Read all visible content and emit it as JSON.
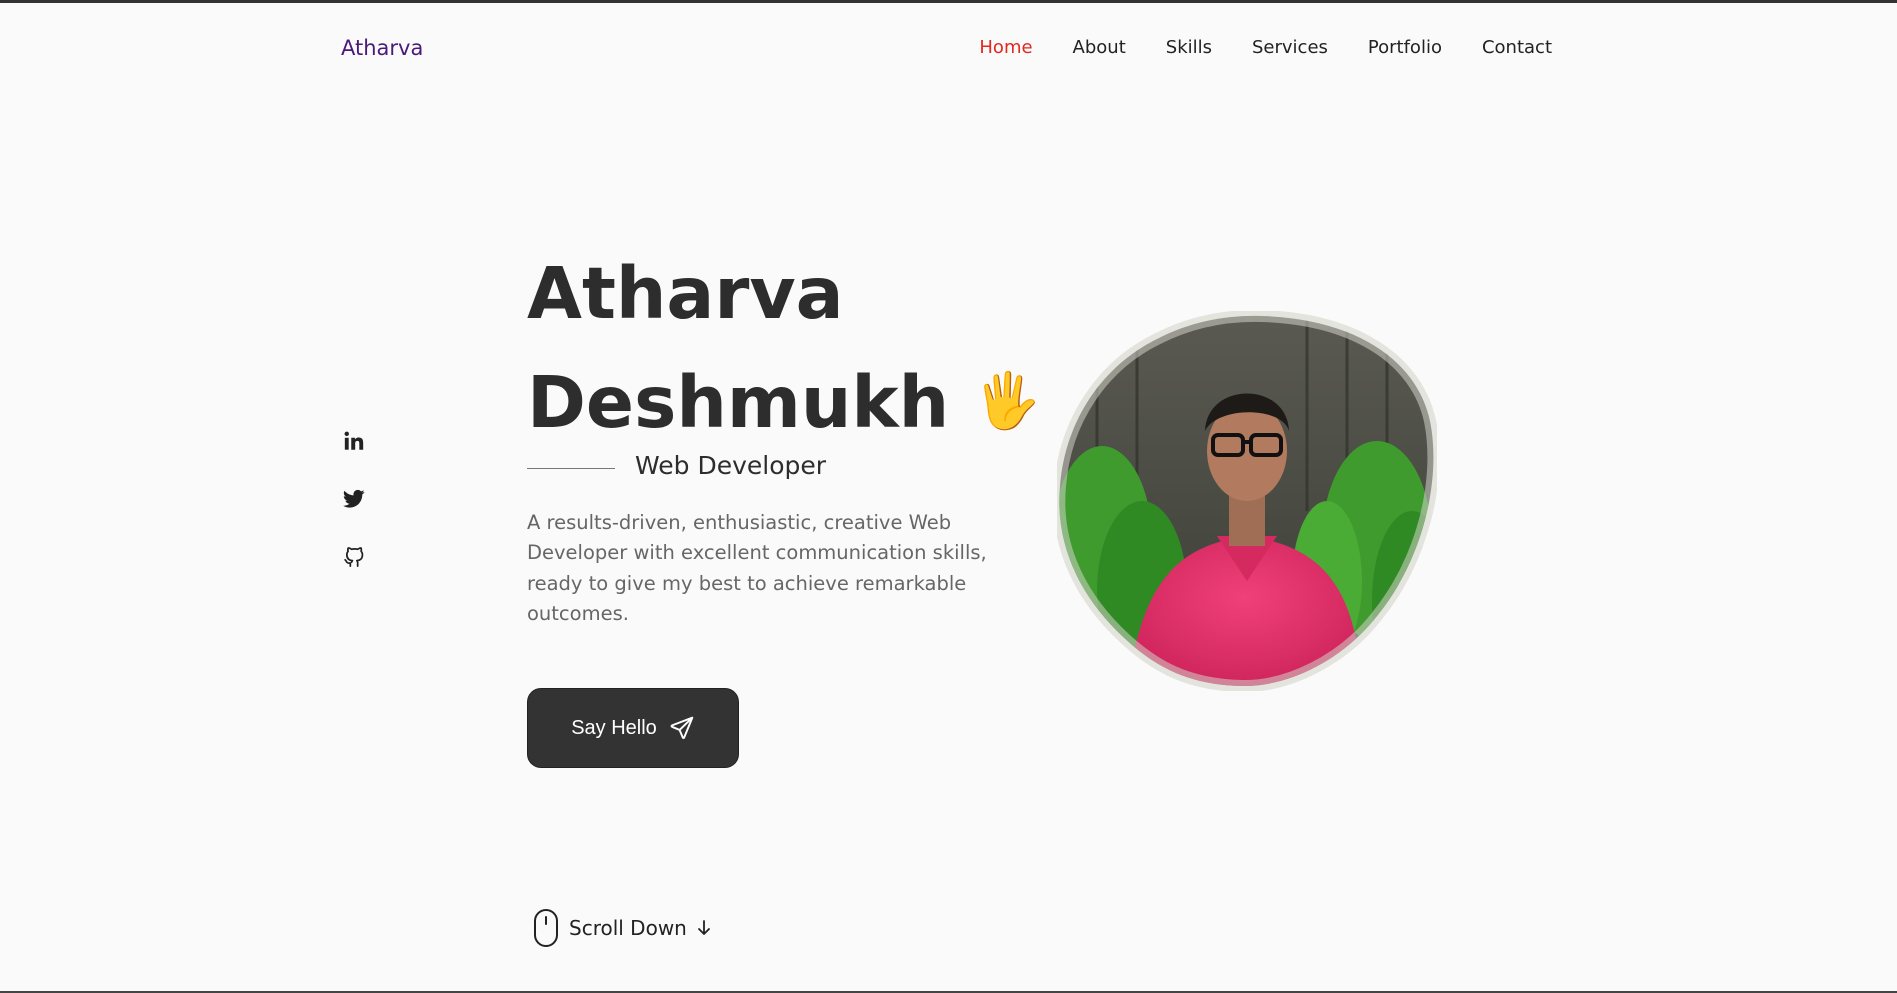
{
  "header": {
    "logo": "Atharva",
    "nav": [
      {
        "label": "Home",
        "active": true
      },
      {
        "label": "About",
        "active": false
      },
      {
        "label": "Skills",
        "active": false
      },
      {
        "label": "Services",
        "active": false
      },
      {
        "label": "Portfolio",
        "active": false
      },
      {
        "label": "Contact",
        "active": false
      }
    ]
  },
  "social": [
    "linkedin-icon",
    "twitter-icon",
    "github-icon"
  ],
  "hero": {
    "first_name": "Atharva",
    "last_name": "Deshmukh",
    "wave": "🖐",
    "subtitle": "Web Developer",
    "description": "A results-driven, enthusiastic, creative Web Developer with excellent communication skills, ready to give my best to achieve remarkable outcomes.",
    "cta_label": "Say Hello"
  },
  "scroll": {
    "label": "Scroll Down"
  },
  "colors": {
    "accent_active": "#e0281f",
    "logo": "#4a1a7a",
    "button_bg": "#333333",
    "background": "#fafafa"
  }
}
